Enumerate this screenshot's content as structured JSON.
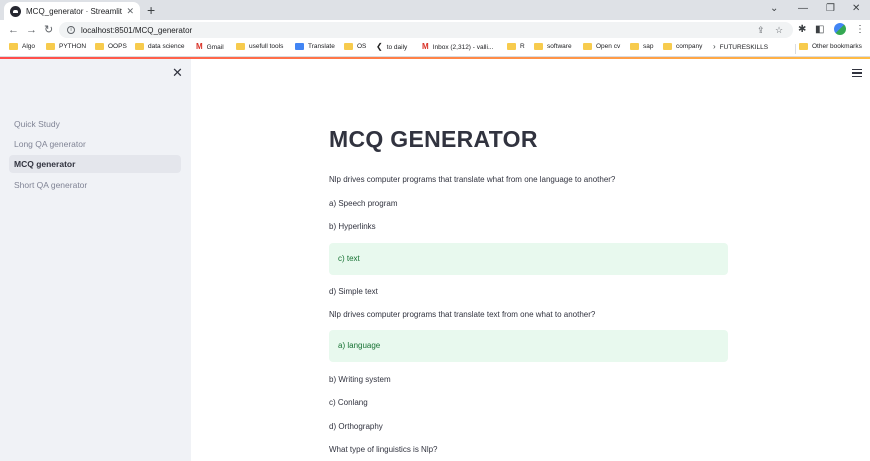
{
  "browser": {
    "tab_title": "MCQ_generator · Streamlit",
    "tab_close": "✕",
    "new_tab": "+",
    "window_controls": {
      "chevron": "⌄",
      "minimize": "—",
      "restore": "❐",
      "close": "✕"
    },
    "nav": {
      "back": "←",
      "forward": "→",
      "reload": "↻"
    },
    "url": "localhost:8501/MCQ_generator",
    "icons": {
      "share": "⇪",
      "star": "☆",
      "extensions": "✱",
      "sidebar": "◧",
      "menu": "⋮"
    },
    "bookmarks": [
      "Algo",
      "PYTHON",
      "OOPS",
      "data science",
      "Gmail",
      "usefull tools",
      "Translate",
      "OS",
      "to daily",
      "Inbox (2,312) - valli...",
      "R",
      "software",
      "Open cv",
      "sap",
      "company",
      "FUTURESKILLS",
      "Other bookmarks"
    ]
  },
  "sidebar": {
    "close": "✕",
    "items": [
      {
        "label": "Quick Study"
      },
      {
        "label": "Long QA generator"
      },
      {
        "label": "MCQ generator"
      },
      {
        "label": "Short QA generator"
      }
    ]
  },
  "main": {
    "title": "MCQ GENERATOR",
    "q1": {
      "question": "Nlp drives computer programs that translate what from one language to another?",
      "options": [
        "a) Speech program",
        "b) Hyperlinks",
        "c) text",
        "d) Simple text"
      ]
    },
    "q2": {
      "question": "Nlp drives computer programs that translate text from one what to another?",
      "options": [
        "a) language",
        "b) Writing system",
        "c) Conlang",
        "d) Orthography"
      ]
    },
    "q3": {
      "question": "What type of linguistics is Nlp?"
    }
  },
  "colors": {
    "sidebar_bg": "#f0f2f6",
    "active_item_bg": "#e4e6ec",
    "answer_bg": "#e8f9ee",
    "answer_text": "#177233",
    "accent_red": "#ff4b4b"
  }
}
